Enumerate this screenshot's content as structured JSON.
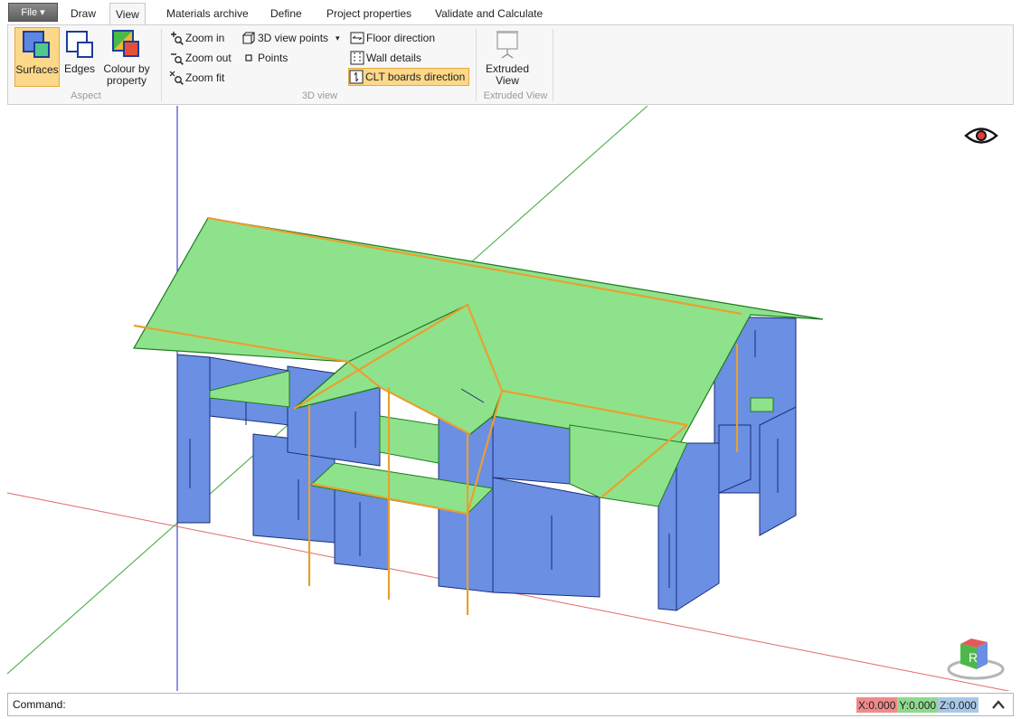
{
  "tabs": {
    "file": "File ▾",
    "items": [
      "Draw",
      "View",
      "Materials archive",
      "Define",
      "Project properties",
      "Validate and Calculate"
    ],
    "active": "View"
  },
  "ribbon": {
    "aspect": {
      "label": "Aspect",
      "surfaces": "Surfaces",
      "edges": "Edges",
      "colour_by_property_1": "Colour by",
      "colour_by_property_2": "property"
    },
    "view3d": {
      "label": "3D view",
      "zoom_in": "Zoom in",
      "zoom_out": "Zoom out",
      "zoom_fit": "Zoom fit",
      "view_points": "3D view points",
      "points": "Points",
      "floor_direction": "Floor direction",
      "wall_details": "Wall details",
      "clt_boards_direction": "CLT boards direction"
    },
    "extruded": {
      "label": "Extruded View",
      "button_1": "Extruded",
      "button_2": "View"
    }
  },
  "navcube": {
    "face_label": "R"
  },
  "command": {
    "label": "Command:",
    "x_label": "X:",
    "x_value": "0.000",
    "y_label": "Y:",
    "y_value": "0.000",
    "z_label": "Z:",
    "z_value": "0.000"
  },
  "colors": {
    "wall": "#6a8fe3",
    "roof": "#8fe28c",
    "edge_orange": "#e8a030",
    "axis_x": "#d02020",
    "axis_y": "#1f8a1f",
    "axis_z": "#2222cc",
    "active_button": "#fcd88a"
  }
}
